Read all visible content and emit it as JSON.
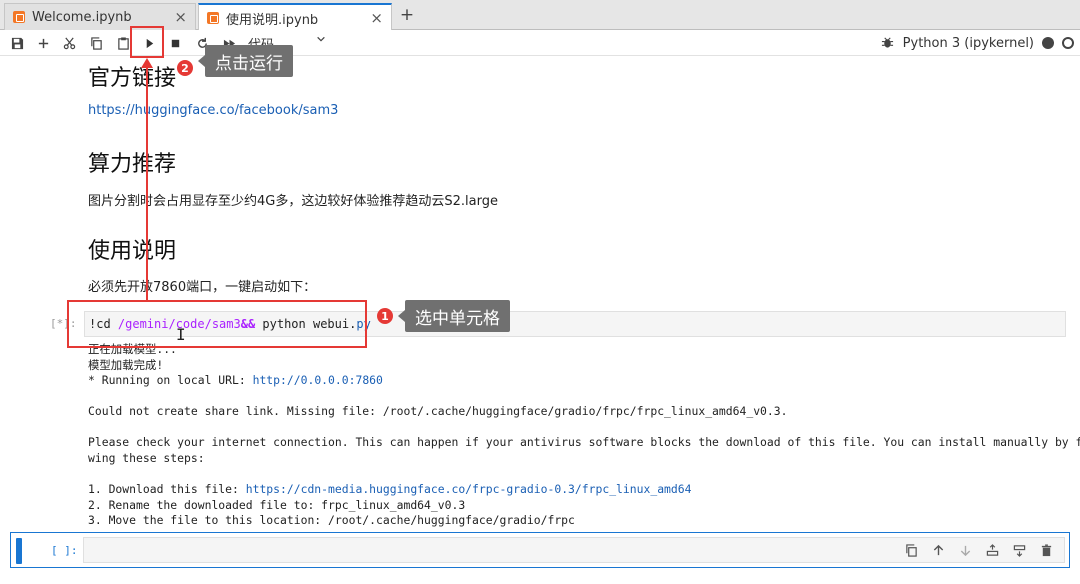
{
  "tabs": [
    {
      "label": "Welcome.ipynb",
      "close": "×"
    },
    {
      "label": "使用说明.ipynb",
      "close": "×"
    }
  ],
  "add_tab": "+",
  "toolbar": {
    "cell_type": "代码",
    "kernel_name": "Python 3 (ipykernel)"
  },
  "markdown": {
    "heading1": "官方链接",
    "link": "https://huggingface.co/facebook/sam3",
    "heading2": "算力推荐",
    "para2": "图片分割时会占用显存至少约4G多，这边较好体验推荐趋动云S2.large",
    "heading3": "使用说明",
    "para3": "必须先开放7860端口，一键启动如下："
  },
  "code_cell": {
    "prompt": "[*]:",
    "cmd": "!cd ",
    "path": "/gemini/code/sam3",
    "op": "&&",
    "python": " python webui.",
    "py": "py"
  },
  "output": {
    "line1": "正在加载模型...",
    "line2": "模型加载完成!",
    "line3_prefix": "* Running on local URL:  ",
    "line3_link": "http://0.0.0.0:7860",
    "line4": "Could not create share link. Missing file: /root/.cache/huggingface/gradio/frpc/frpc_linux_amd64_v0.3.",
    "line5": "Please check your internet connection. This can happen if your antivirus software blocks the download of this file. You can install manually by follo",
    "line6": "wing these steps:",
    "line7_prefix": "1. Download this file: ",
    "line7_link": "https://cdn-media.huggingface.co/frpc-gradio-0.3/frpc_linux_amd64",
    "line8": "2. Rename the downloaded file to: frpc_linux_amd64_v0.3",
    "line9": "3. Move the file to this location: /root/.cache/huggingface/gradio/frpc"
  },
  "empty_cell": {
    "prompt": "[ ]:"
  },
  "annotations": {
    "step1_num": "1",
    "step1_text": "选中单元格",
    "step2_num": "2",
    "step2_text": "点击运行",
    "color": "#e53935"
  },
  "icons": [
    "save-icon",
    "add-cell-icon",
    "cut-icon",
    "copy-icon",
    "paste-icon",
    "run-icon",
    "stop-icon",
    "restart-icon",
    "fast-forward-icon",
    "debugger-icon",
    "kernel-status-icon",
    "kernel-idle-icon"
  ]
}
